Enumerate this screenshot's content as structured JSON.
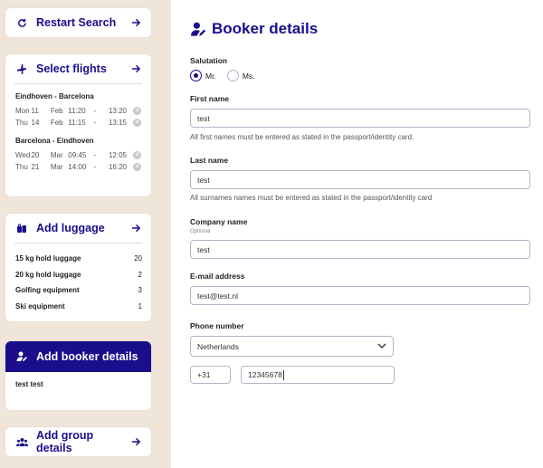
{
  "sidebar": {
    "restart": {
      "label": "Restart Search"
    },
    "flights": {
      "label": "Select flights",
      "legs": [
        {
          "route": "Eindhoven - Barcelona",
          "rows": [
            {
              "day": "Mon",
              "date": "11",
              "month": "Feb",
              "dep": "11:20",
              "dash": "-",
              "arr": "13:20"
            },
            {
              "day": "Thu",
              "date": "14",
              "month": "Feb",
              "dep": "11:15",
              "dash": "-",
              "arr": "13:15"
            }
          ]
        },
        {
          "route": "Barcelona - Eindhoven",
          "rows": [
            {
              "day": "Wed",
              "date": "20",
              "month": "Mar",
              "dep": "09:45",
              "dash": "-",
              "arr": "12:05"
            },
            {
              "day": "Thu",
              "date": "21",
              "month": "Mar",
              "dep": "14:00",
              "dash": "-",
              "arr": "16:20"
            }
          ]
        }
      ]
    },
    "luggage": {
      "label": "Add luggage",
      "items": [
        {
          "name": "15 kg hold luggage",
          "qty": "20"
        },
        {
          "name": "20 kg hold luggage",
          "qty": "2"
        },
        {
          "name": "Golfing equipment",
          "qty": "3"
        },
        {
          "name": "Ski equipment",
          "qty": "1"
        }
      ]
    },
    "booker": {
      "label": "Add booker details",
      "name": "test test"
    },
    "group": {
      "label": "Add group details"
    }
  },
  "main": {
    "title": "Booker details",
    "salutation": {
      "label": "Salutation",
      "options": [
        "Mr.",
        "Ms."
      ],
      "selected": "Mr."
    },
    "first_name": {
      "label": "First name",
      "value": "test",
      "hint": "All first names must be entered as stated in the passport/identity card."
    },
    "last_name": {
      "label": "Last name",
      "value": "test",
      "hint": "All surnames names must be entered as stated in the passport/identity card"
    },
    "company": {
      "label": "Company name",
      "optional": "Optional",
      "value": "test"
    },
    "email": {
      "label": "E-mail address",
      "value": "test@test.nl"
    },
    "phone": {
      "label": "Phone number",
      "country": "Netherlands",
      "code": "+31",
      "number": "12345678"
    }
  },
  "colors": {
    "accent": "#1a0e8c",
    "sidebar_bg": "#efe5d9"
  }
}
